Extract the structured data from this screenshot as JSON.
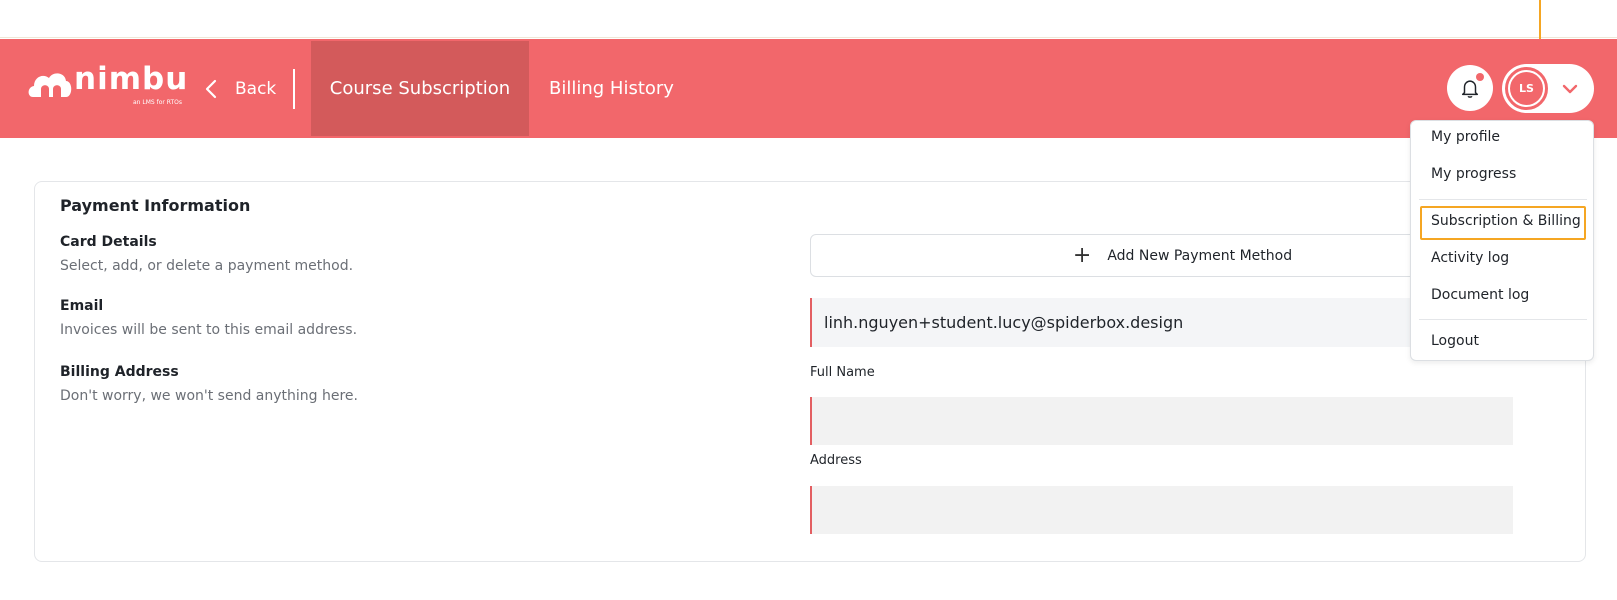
{
  "header": {
    "logo_text": "nimbu",
    "logo_tagline": "an LMS for RTOs",
    "back_label": "Back",
    "tabs": [
      {
        "label": "Course Subscription",
        "active": true
      },
      {
        "label": "Billing History",
        "active": false
      }
    ],
    "user_initials": "LS"
  },
  "payment": {
    "title": "Payment Information",
    "sections": [
      {
        "label": "Card Details",
        "description": "Select, add, or delete a payment method."
      },
      {
        "label": "Email",
        "description": "Invoices will be sent to this email address."
      },
      {
        "label": "Billing Address",
        "description": "Don't worry, we won't send anything here."
      }
    ],
    "add_method_label": "Add New Payment Method",
    "email_value": "linh.nguyen+student.lucy@spiderbox.design",
    "full_name_label": "Full Name",
    "full_name_value": "",
    "address_label": "Address",
    "address_value": ""
  },
  "user_menu": {
    "items": [
      "My profile",
      "My progress",
      "Subscription & Billing",
      "Activity log",
      "Document log",
      "Logout"
    ],
    "highlighted": "Subscription & Billing"
  },
  "colors": {
    "brand": "#f2676b",
    "brand_dark": "#d35a5b",
    "highlight": "#f5a623"
  }
}
